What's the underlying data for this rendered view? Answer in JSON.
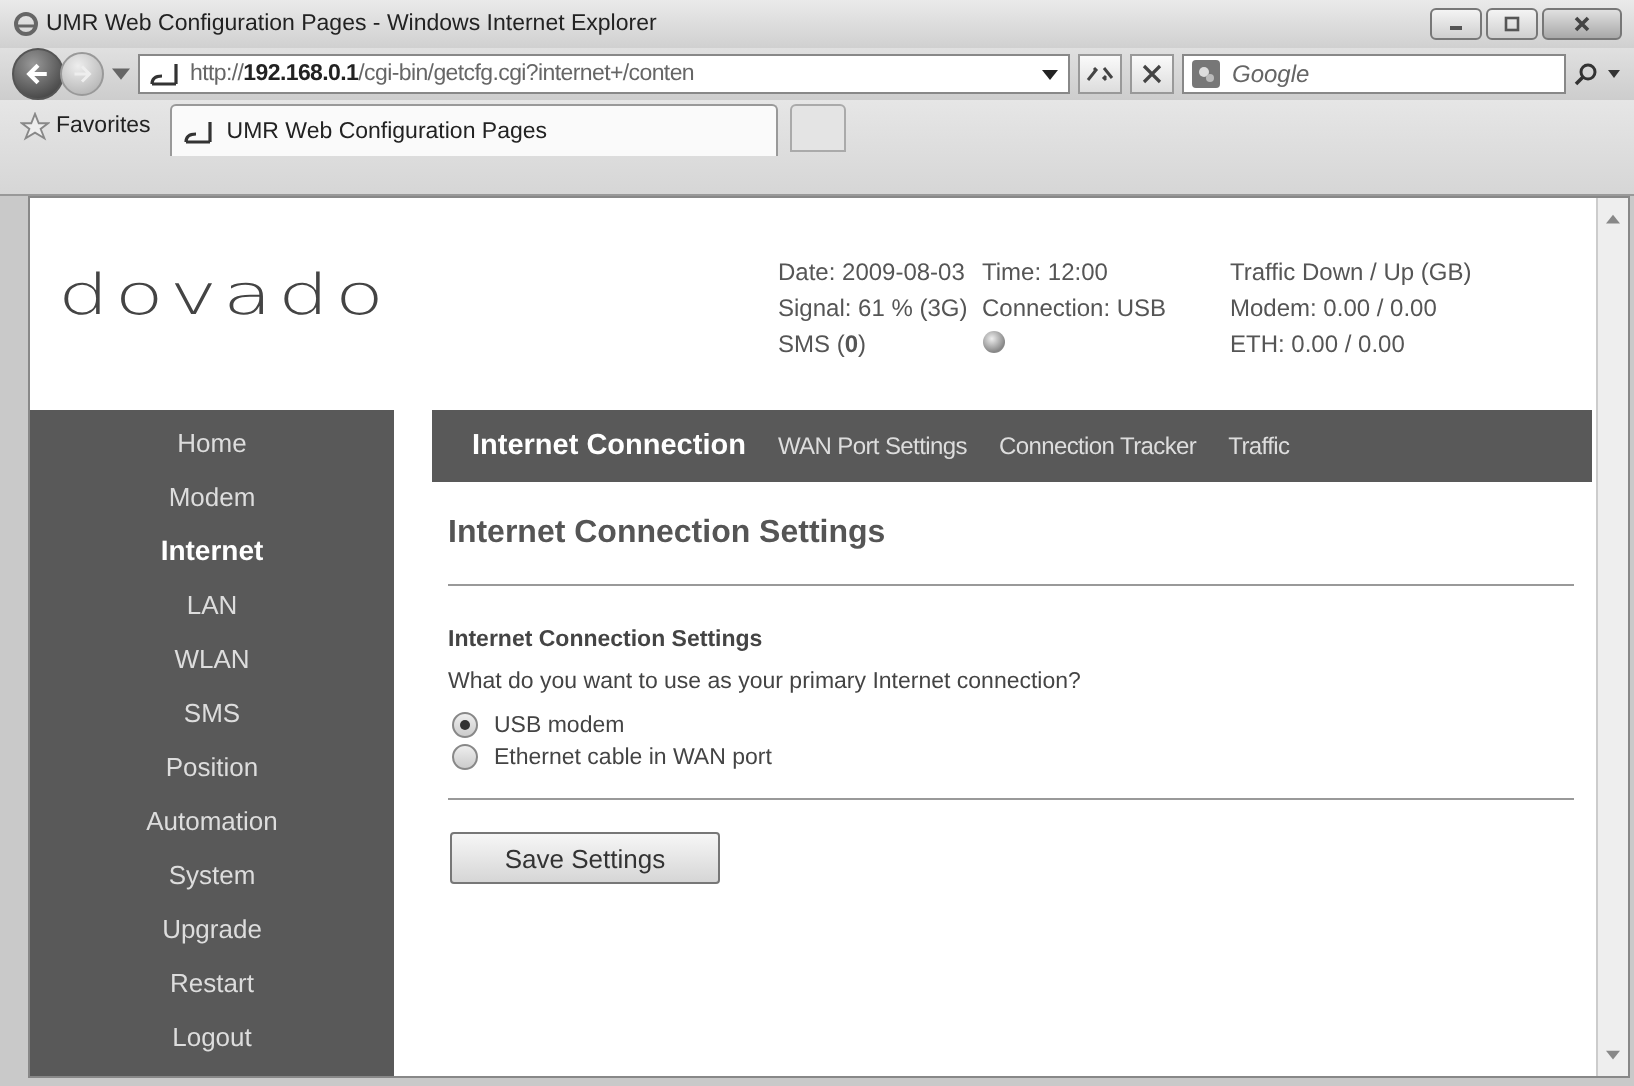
{
  "window": {
    "title": "UMR Web Configuration Pages - Windows Internet Explorer"
  },
  "address_bar": {
    "url": "http://**192.168.0.1**/cgi-bin/getcfg.cgi?internet+/conten"
  },
  "search": {
    "placeholder": "Google"
  },
  "favorites": {
    "label": "Favorites"
  },
  "tabs": [
    {
      "label": "UMR Web Configuration Pages",
      "selected": true
    }
  ],
  "logo": "dovado",
  "status": [
    [
      "Date: 2009-08-03",
      "Signal: 61 % (3G)",
      "SMS (**0**)"
    ],
    [
      "Time: 12:00",
      "Connection: USB"
    ],
    [
      "Traffic Down / Up (GB)",
      "Modem: 0.00 / 0.00",
      "ETH: 0.00 / 0.00"
    ]
  ],
  "sidebar": {
    "items": [
      {
        "label": "Home",
        "selected": false
      },
      {
        "label": "Modem",
        "selected": false
      },
      {
        "label": "Internet",
        "selected": true
      },
      {
        "label": "LAN",
        "selected": false
      },
      {
        "label": "WLAN",
        "selected": false
      },
      {
        "label": "SMS",
        "selected": false
      },
      {
        "label": "Position",
        "selected": false
      },
      {
        "label": "Automation",
        "selected": false
      },
      {
        "label": "System",
        "selected": false
      },
      {
        "label": "Upgrade",
        "selected": false
      },
      {
        "label": "Restart",
        "selected": false
      },
      {
        "label": "Logout",
        "selected": false
      }
    ]
  },
  "subnav": [
    {
      "label": "Internet Connection",
      "selected": true
    },
    {
      "label": "WAN Port Settings",
      "selected": false
    },
    {
      "label": "Connection Tracker",
      "selected": false
    },
    {
      "label": "Traffic",
      "selected": false
    }
  ],
  "heading": "Internet Connection Settings",
  "form": {
    "title": "Internet Connection Settings",
    "question": "What do you want to use as your primary Internet connection?",
    "options": [
      {
        "label": "USB modem",
        "selected": true
      },
      {
        "label": "Ethernet cable in WAN port",
        "selected": false
      }
    ]
  },
  "buttons": [
    "Save Settings"
  ]
}
